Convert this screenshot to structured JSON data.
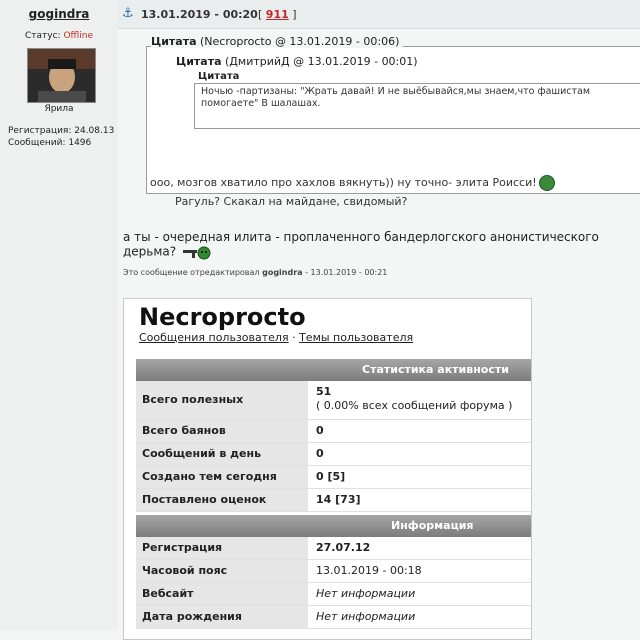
{
  "user": {
    "name": "gogindra",
    "status_label": "Статус:",
    "status_value": "Offline",
    "avatar_name": "Ярила",
    "registration": "Регистрация: 24.08.13",
    "messages": "Сообщений: 1496"
  },
  "post": {
    "date": "13.01.2019 - 00:20",
    "count_open": "[ ",
    "count": "911",
    "count_close": " ]",
    "main_text": "а ты - очередная илита - проплаченного бандерлогского анонистического дерьма?",
    "edited_prefix": "Это сообщение отредактировал",
    "edited_user": "gogindra",
    "edited_suffix": "- 13.01.2019 - 00:21"
  },
  "quotes": {
    "q1_title_bold": "Цитата",
    "q1_title_rest": " (Necroprocto @ 13.01.2019 - 00:06)",
    "q1_response": "ооо, мозгов хватило про хахлов вякнуть)) ну точно- элита Роисси!",
    "q2_title_bold": "Цитата",
    "q2_title_rest": " (ДмитрийД @ 13.01.2019 - 00:01)",
    "q2_response": "Рагуль? Скакал на майдане, свидомый?",
    "q3_title": "Цитата",
    "q3_text": "Ночью -партизаны: \"Жрать давай! И не выёбывайся,мы знаем,что фашистам помогаете\" В шалашах."
  },
  "profile": {
    "name": "Necroprocto",
    "link_messages": "Сообщения пользователя",
    "link_sep": " · ",
    "link_topics": "Темы пользователя",
    "stats_header": "Статистика активности",
    "stats": [
      {
        "key": "Всего полезных сообщений",
        "value": "51",
        "value2": "( 0.00% всех сообщений форума )"
      },
      {
        "key": "Всего баянов",
        "value": "0"
      },
      {
        "key": "Сообщений в день",
        "value": "0"
      },
      {
        "key": "Создано тем сегодня",
        "value": "0 [5]"
      },
      {
        "key": "Поставлено оценок сегодня",
        "value": "14 [73]"
      }
    ],
    "info_header": "Информация",
    "info": [
      {
        "key": "Регистрация",
        "value": "27.07.12"
      },
      {
        "key": "Часовой пояс пользователя",
        "value": "13.01.2019 - 00:18"
      },
      {
        "key": "Вебсайт",
        "value": "Нет информации"
      },
      {
        "key": "Дата рождения",
        "value": "Нет информации"
      }
    ]
  },
  "colors": {
    "offline": "#c03020",
    "post_count": "#c0262c",
    "table_header": "#8c8c8c"
  }
}
